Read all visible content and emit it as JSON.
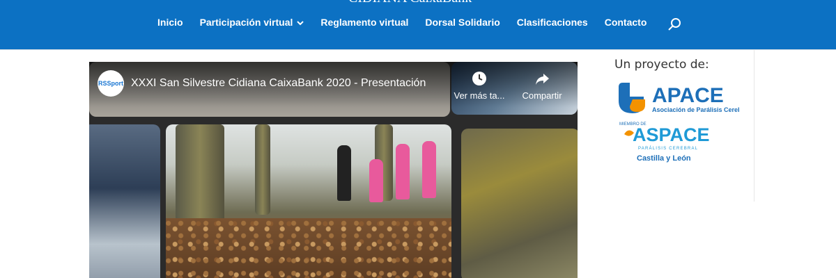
{
  "header": {
    "logo_text": "CIDIANA CaixaBank",
    "nav": [
      {
        "label": "Inicio"
      },
      {
        "label": "Participación virtual",
        "has_dropdown": true
      },
      {
        "label": "Reglamento virtual"
      },
      {
        "label": "Dorsal Solidario"
      },
      {
        "label": "Clasificaciones"
      },
      {
        "label": "Contacto"
      }
    ],
    "search_icon": "search-icon"
  },
  "video": {
    "channel_logo": "RSSport",
    "title": "XXXI San Silvestre Cidiana CaixaBank 2020 - Presentación",
    "watch_later": "Ver más ta...",
    "share": "Compartir"
  },
  "sidebar": {
    "title": "Un proyecto de:",
    "apace_name": "APACE",
    "apace_subtitle": "Asociación de Parálisis Cerebral",
    "member_of": "MIEMBRO DE",
    "aspace_name": "ASPACE",
    "aspace_subtitle": "PARÁLISIS CEREBRAL",
    "region": "Castilla y León"
  },
  "colors": {
    "header_bg": "#0c71c3",
    "apace_blue": "#1d6fb8",
    "apace_orange": "#f39200"
  }
}
